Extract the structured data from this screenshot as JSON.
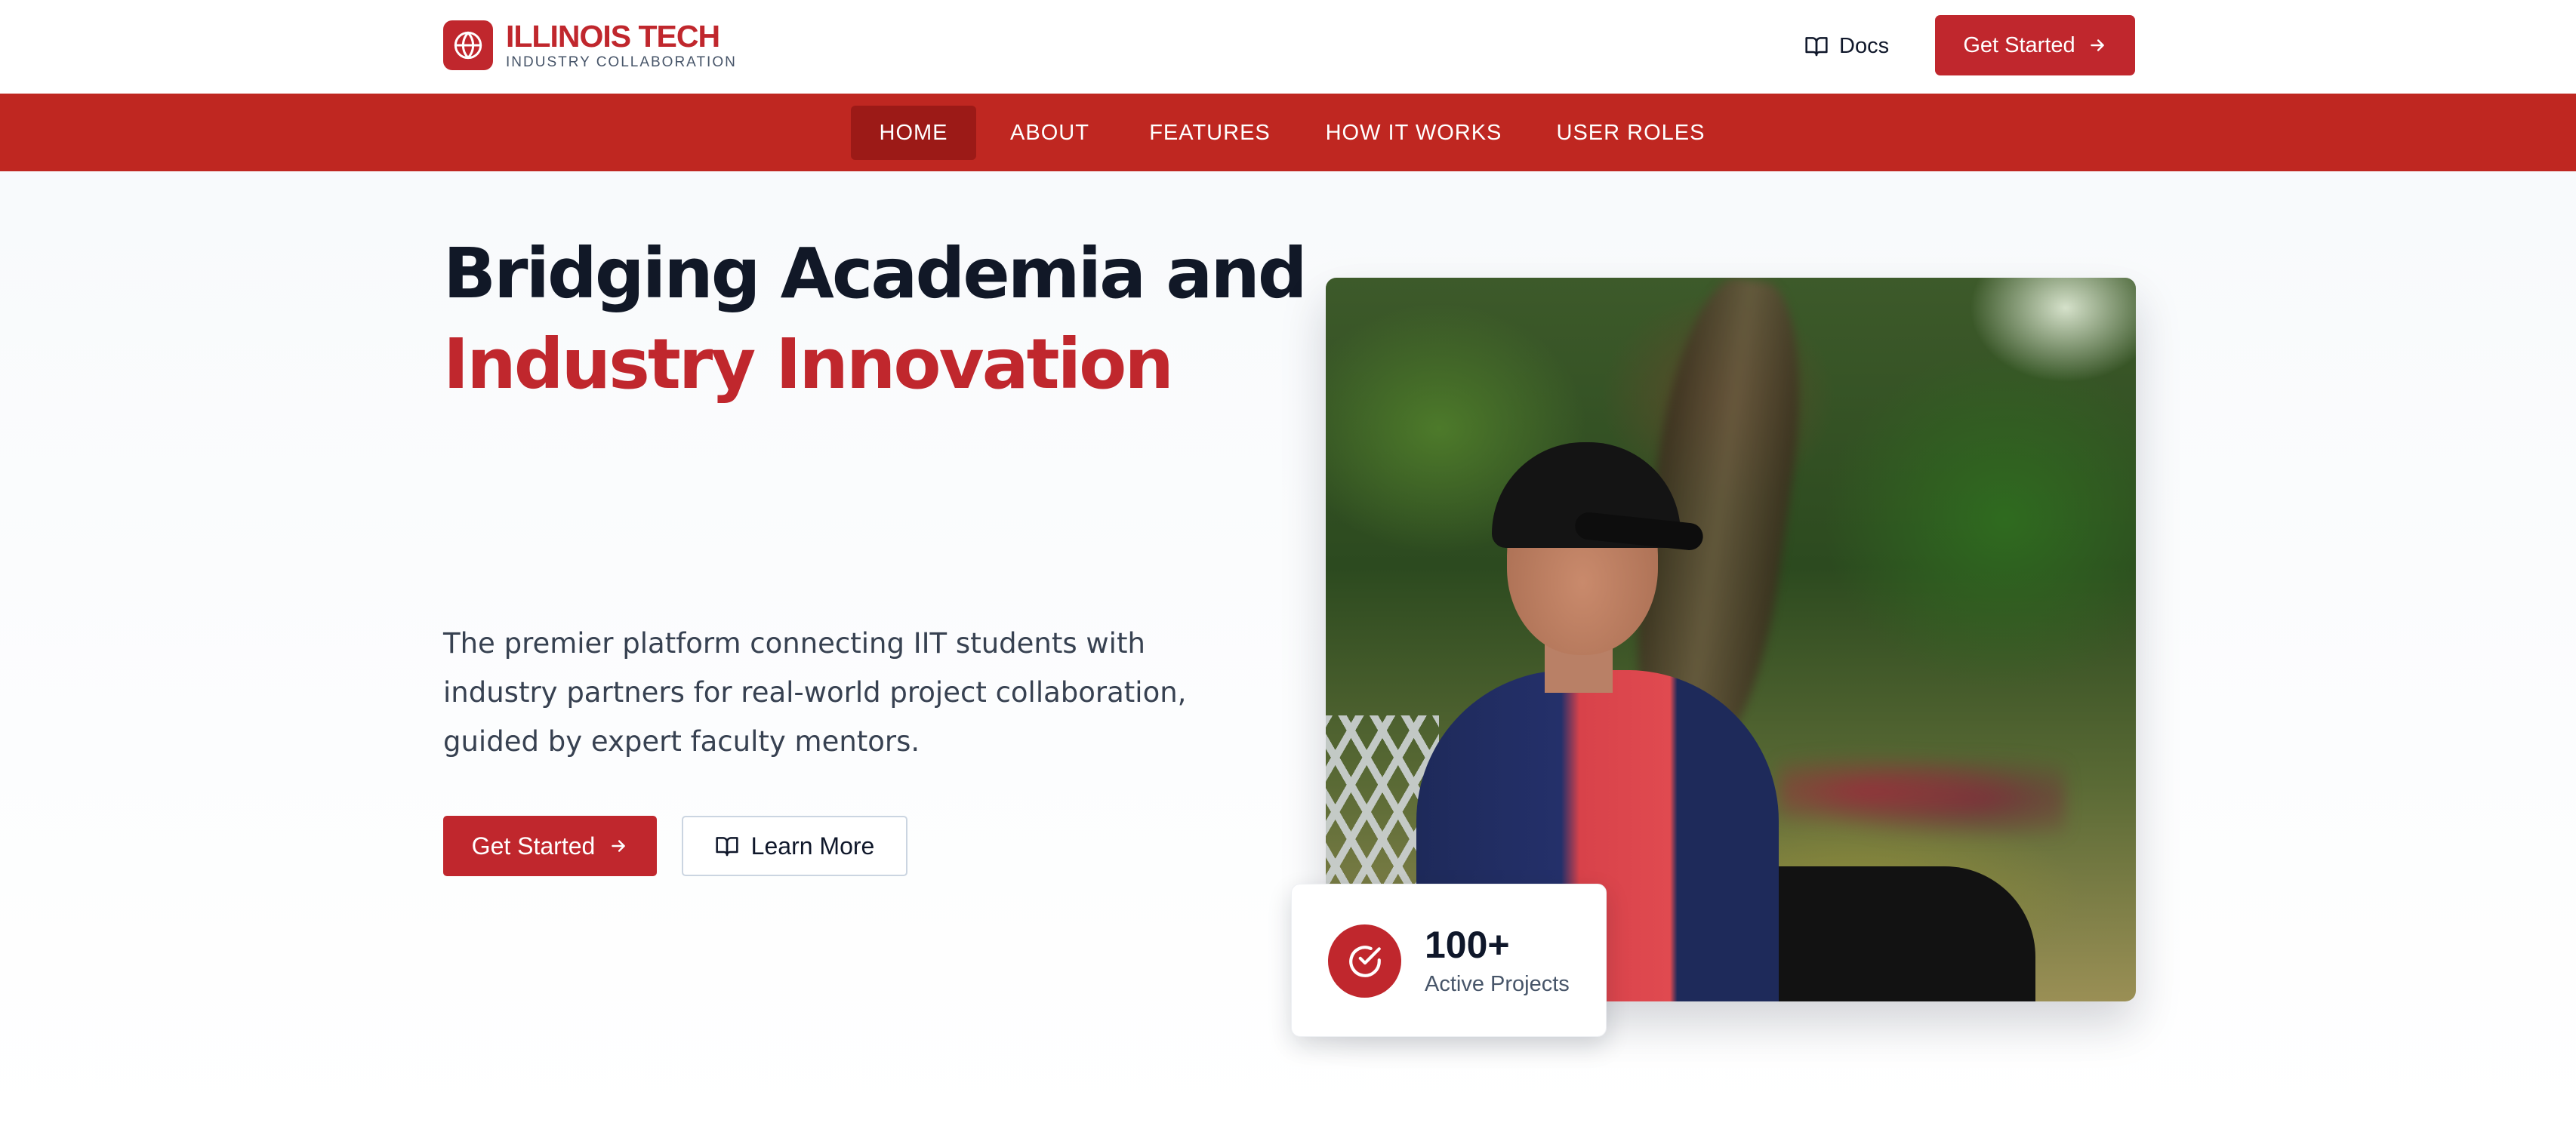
{
  "header": {
    "brand": {
      "title": "ILLINOIS TECH",
      "subtitle": "INDUSTRY COLLABORATION",
      "icon": "globe-icon"
    },
    "docs_label": "Docs",
    "docs_icon": "book-open-icon",
    "cta_label": "Get Started",
    "cta_icon": "arrow-right-icon"
  },
  "nav": {
    "items": [
      {
        "label": "HOME",
        "active": true
      },
      {
        "label": "ABOUT",
        "active": false
      },
      {
        "label": "FEATURES",
        "active": false
      },
      {
        "label": "HOW IT WORKS",
        "active": false
      },
      {
        "label": "USER ROLES",
        "active": false
      }
    ]
  },
  "hero": {
    "title_line1": "Bridging Academia and",
    "title_line2": "Industry Innovation",
    "description": "The premier platform connecting IIT students with industry partners for real-world project collaboration, guided by expert faculty mentors.",
    "primary_button": "Get Started",
    "secondary_button": "Learn More",
    "secondary_icon": "book-open-icon"
  },
  "stat": {
    "value": "100+",
    "label": "Active Projects",
    "icon": "check-circle-icon"
  },
  "colors": {
    "brand_red": "#c0272d",
    "nav_red": "#bf2721",
    "nav_active": "#9c1a17",
    "heading_dark": "#111827",
    "body_text": "#374151"
  }
}
